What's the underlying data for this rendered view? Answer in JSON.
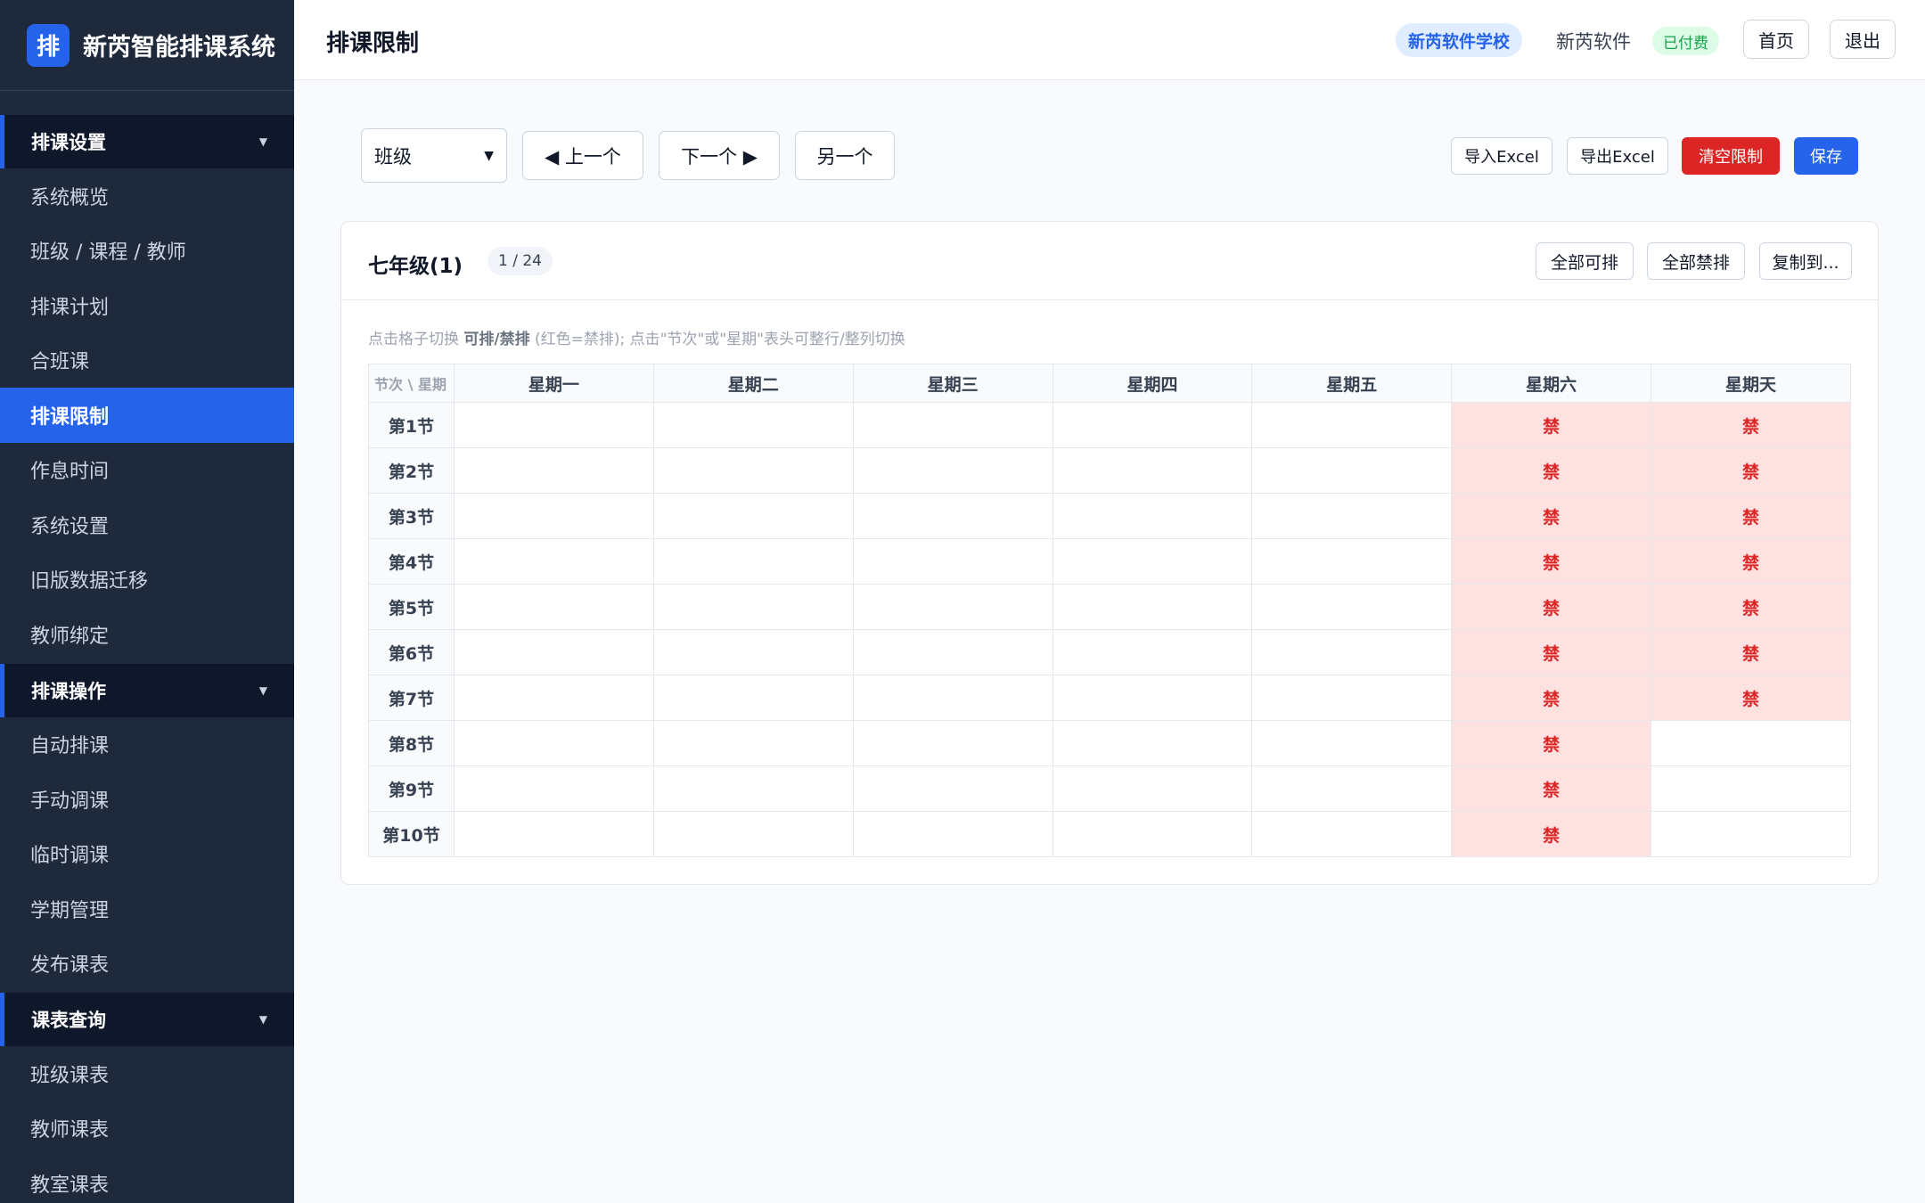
{
  "brand": {
    "logo_char": "排",
    "title": "新芮智能排课系统"
  },
  "sidebar": {
    "groups": [
      {
        "title": "排课设置",
        "items": [
          "系统概览",
          "班级 / 课程 / 教师",
          "排课计划",
          "合班课",
          "排课限制",
          "作息时间",
          "系统设置",
          "旧版数据迁移",
          "教师绑定"
        ],
        "active_index": 4
      },
      {
        "title": "排课操作",
        "items": [
          "自动排课",
          "手动调课",
          "临时调课",
          "学期管理",
          "发布课表"
        ]
      },
      {
        "title": "课表查询",
        "items": [
          "班级课表",
          "教师课表",
          "教室课表"
        ]
      }
    ]
  },
  "topbar": {
    "page_title": "排课限制",
    "school": "新芮软件学校",
    "user": "新芮软件",
    "paid": "已付费",
    "home": "首页",
    "logout": "退出"
  },
  "toolbar": {
    "select_value": "班级",
    "prev": "◀ 上一个",
    "next": "下一个 ▶",
    "another": "另一个",
    "import": "导入Excel",
    "export": "导出Excel",
    "clear": "清空限制",
    "save": "保存"
  },
  "card": {
    "title": "七年级(1)",
    "counter": "1 / 24",
    "all_allow": "全部可排",
    "all_ban": "全部禁排",
    "copy_to": "复制到...",
    "hint_prefix": "点击格子切换 ",
    "hint_bold": "可排/禁排",
    "hint_suffix": " (红色=禁排); 点击\"节次\"或\"星期\"表头可整行/整列切换"
  },
  "grid": {
    "corner": "节次 \\ 星期",
    "days": [
      "星期一",
      "星期二",
      "星期三",
      "星期四",
      "星期五",
      "星期六",
      "星期天"
    ],
    "periods": [
      "第1节",
      "第2节",
      "第3节",
      "第4节",
      "第5节",
      "第6节",
      "第7节",
      "第8节",
      "第9节",
      "第10节"
    ],
    "ban_label": "禁",
    "banned": [
      [
        0,
        0,
        0,
        0,
        0,
        1,
        1
      ],
      [
        0,
        0,
        0,
        0,
        0,
        1,
        1
      ],
      [
        0,
        0,
        0,
        0,
        0,
        1,
        1
      ],
      [
        0,
        0,
        0,
        0,
        0,
        1,
        1
      ],
      [
        0,
        0,
        0,
        0,
        0,
        1,
        1
      ],
      [
        0,
        0,
        0,
        0,
        0,
        1,
        1
      ],
      [
        0,
        0,
        0,
        0,
        0,
        1,
        1
      ],
      [
        0,
        0,
        0,
        0,
        0,
        1,
        0
      ],
      [
        0,
        0,
        0,
        0,
        0,
        1,
        0
      ],
      [
        0,
        0,
        0,
        0,
        0,
        1,
        0
      ]
    ]
  }
}
